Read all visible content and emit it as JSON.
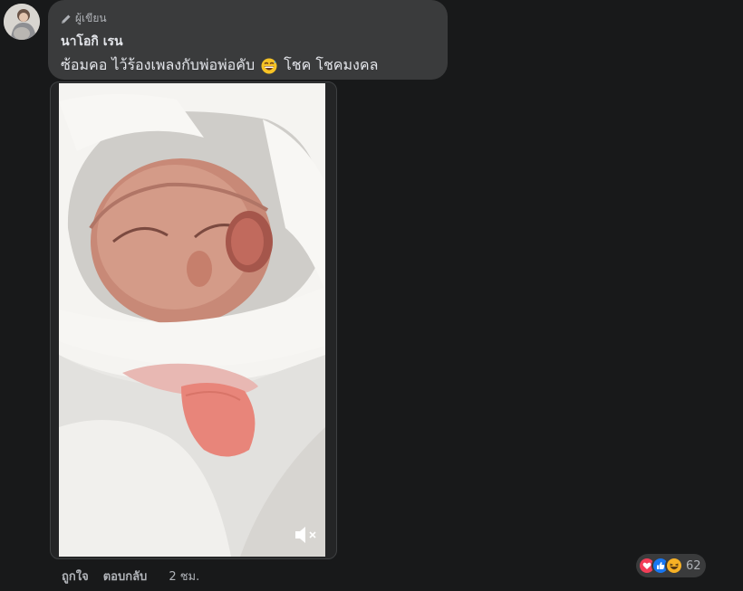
{
  "comment": {
    "author_badge": "ผู้เขียน",
    "commenter_name": "นาโอกิ เรน",
    "text_part1": "ซ้อมคอ ไว้ร้องเพลงกับพ่อพ่อคับ",
    "text_part2": "โชค โชคมงคล",
    "emoji_icon": "grinning-sweat-emoji"
  },
  "video": {
    "muted": true,
    "mute_icon": "speaker-muted-icon"
  },
  "actions": {
    "like_label": "ถูกใจ",
    "reply_label": "ตอบกลับ",
    "time_label": "2 ชม."
  },
  "reactions": {
    "icons": [
      "love-reaction-icon",
      "like-reaction-icon",
      "haha-reaction-icon"
    ],
    "count": "62"
  },
  "colors": {
    "background": "#18191a",
    "bubble": "#3a3b3c",
    "primary_text": "#e4e6eb",
    "secondary_text": "#b0b3b8",
    "love": "#f33e58",
    "like": "#1877f2",
    "haha": "#f7b125"
  }
}
